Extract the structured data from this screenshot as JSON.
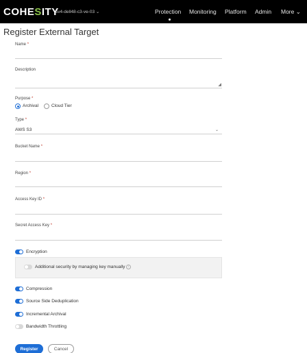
{
  "header": {
    "logo_prefix": "COHE",
    "logo_accent": "S",
    "logo_suffix": "ITY",
    "cluster_name": "sv4-dell48-c3-ve-03 ⌄",
    "nav": [
      "Protection",
      "Monitoring",
      "Platform",
      "Admin",
      "More ⌄"
    ],
    "active_nav": "Protection"
  },
  "page": {
    "title": "Register External Target"
  },
  "form": {
    "name_label": "Name",
    "description_label": "Description",
    "purpose_label": "Purpose",
    "purpose_options": [
      "Archival",
      "Cloud Tier"
    ],
    "purpose_selected": "Archival",
    "type_label": "Type",
    "type_value": "AWS S3",
    "bucket_label": "Bucket Name",
    "region_label": "Region",
    "access_key_label": "Access Key ID",
    "secret_key_label": "Secret Access Key",
    "required_marker": "*",
    "encryption_label": "Encryption",
    "encryption_on": true,
    "additional_security_label": "Additional security by managing key manually",
    "additional_security_on": false,
    "compression_label": "Compression",
    "compression_on": true,
    "dedup_label": "Source Side Deduplication",
    "dedup_on": true,
    "incremental_label": "Incremental Archival",
    "incremental_on": true,
    "throttling_label": "Bandwidth Throttling",
    "throttling_on": false
  },
  "actions": {
    "register_label": "Register",
    "cancel_label": "Cancel"
  },
  "colors": {
    "accent": "#1e6ed6",
    "topbar": "#000000",
    "logo_accent": "#8bc34a"
  }
}
